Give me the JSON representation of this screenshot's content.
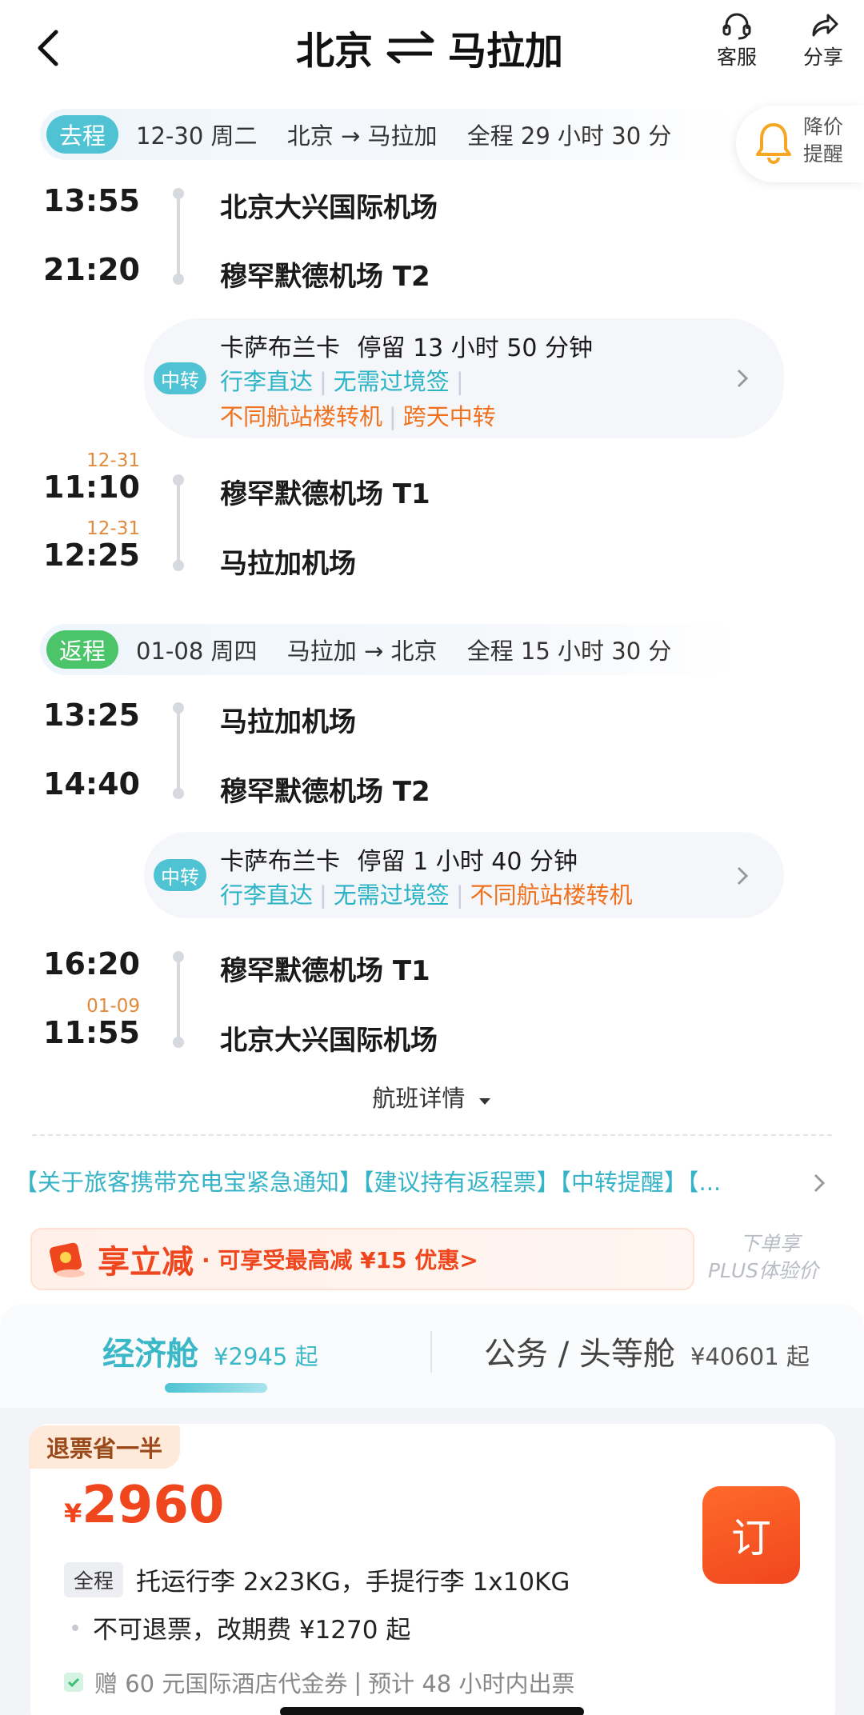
{
  "header": {
    "origin": "北京",
    "destination": "马拉加",
    "service_label": "客服",
    "share_label": "分享"
  },
  "price_alert": {
    "label_line1": "降价",
    "label_line2": "提醒"
  },
  "outbound": {
    "tag": "去程",
    "date": "12-30 周二",
    "route": "北京 → 马拉加",
    "duration": "全程 29 小时 30 分",
    "leg1": {
      "dep_time": "13:55",
      "dep_airport": "北京大兴国际机场",
      "arr_time": "21:20",
      "arr_airport": "穆罕默德机场 T2"
    },
    "transfer": {
      "tag": "中转",
      "city": "卡萨布兰卡",
      "stay": "停留 13 小时 50 分钟",
      "notes_teal": [
        "行李直达",
        "无需过境签"
      ],
      "notes_orange": [
        "不同航站楼转机",
        "跨天中转"
      ]
    },
    "leg2": {
      "dep_date": "12-31",
      "dep_time": "11:10",
      "dep_airport": "穆罕默德机场 T1",
      "arr_date": "12-31",
      "arr_time": "12:25",
      "arr_airport": "马拉加机场"
    }
  },
  "return": {
    "tag": "返程",
    "date": "01-08 周四",
    "route": "马拉加 → 北京",
    "duration": "全程 15 小时 30 分",
    "leg1": {
      "dep_time": "13:25",
      "dep_airport": "马拉加机场",
      "arr_time": "14:40",
      "arr_airport": "穆罕默德机场 T2"
    },
    "transfer": {
      "tag": "中转",
      "city": "卡萨布兰卡",
      "stay": "停留 1 小时 40 分钟",
      "notes_teal": [
        "行李直达",
        "无需过境签"
      ],
      "notes_orange": [
        "不同航站楼转机"
      ]
    },
    "leg2": {
      "dep_time": "16:20",
      "dep_airport": "穆罕默德机场 T1",
      "arr_date": "01-09",
      "arr_time": "11:55",
      "arr_airport": "北京大兴国际机场"
    }
  },
  "flight_details_label": "航班详情",
  "notice_text": "【关于旅客携带充电宝紧急通知】【建议持有返程票】【中转提醒】【...",
  "promo": {
    "title": "享立减",
    "desc": "· 可享受最高减 ¥15 优惠>",
    "plus_line1": "下单享",
    "plus_line2": "PLUS体验价"
  },
  "cabin_tabs": [
    {
      "name": "经济舱",
      "price": "¥2945 起"
    },
    {
      "name": "公务 / 头等舱",
      "price": "¥40601 起"
    }
  ],
  "fare": {
    "badge": "退票省一半",
    "currency": "¥",
    "price": "2960",
    "book_label": "订",
    "scope_pill": "全程",
    "baggage": "托运行李 2x23KG，手提行李 1x10KG",
    "refund_rule": "不可退票，改期费 ¥1270 起",
    "gift": "赠 60 元国际酒店代金券",
    "ticketing": "预计 48 小时内出票"
  },
  "colors": {
    "teal": "#4fc3d4",
    "orange": "#f0711e",
    "price_red": "#f0461e",
    "return_green": "#4cc46a"
  }
}
